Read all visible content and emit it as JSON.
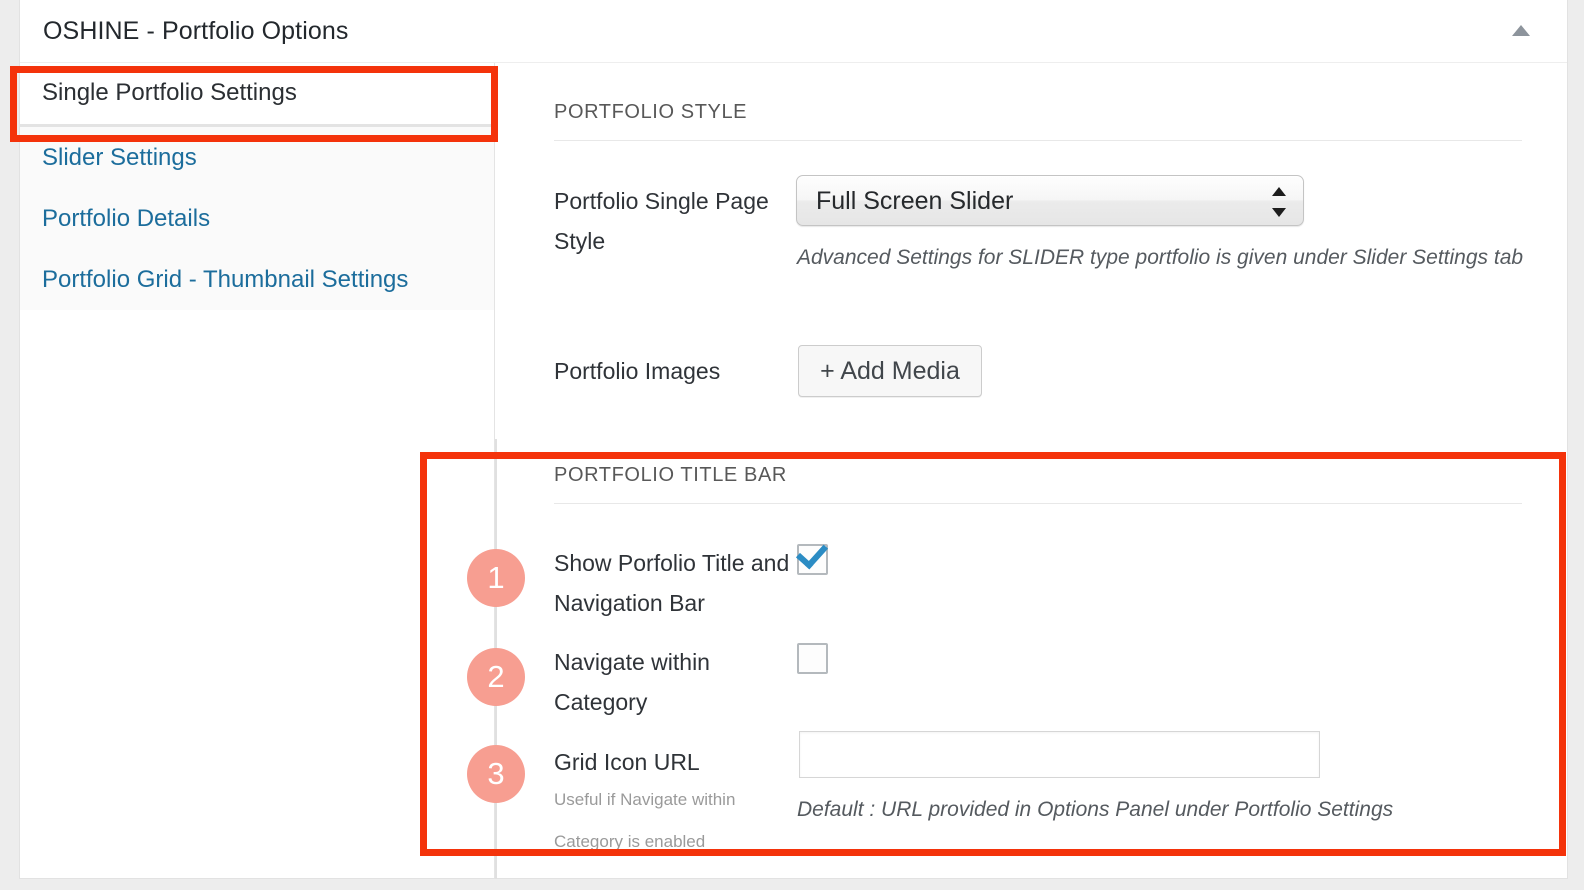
{
  "metabox": {
    "title": "OSHINE - Portfolio Options",
    "toggle_icon": "triangle-up-icon",
    "accent_highlight_color": "#f4330b",
    "badge_color": "#f79e91",
    "link_color": "#1c6d9c"
  },
  "nav": {
    "items": [
      {
        "label": "Single Portfolio Settings",
        "active": true
      },
      {
        "label": "Slider Settings",
        "active": false
      },
      {
        "label": "Portfolio Details",
        "active": false
      },
      {
        "label": "Portfolio Grid - Thumbnail Settings",
        "active": false
      }
    ]
  },
  "sections": [
    {
      "heading": "PORTFOLIO STYLE",
      "fields": [
        {
          "label": "Portfolio Single Page Style",
          "control": "select",
          "value": "Full Screen Slider",
          "description": "Advanced Settings for SLIDER type portfolio is given under Slider Settings tab"
        },
        {
          "label": "Portfolio Images",
          "control": "button",
          "button_label": "+ Add Media"
        }
      ]
    },
    {
      "heading": "PORTFOLIO TITLE BAR",
      "fields": [
        {
          "badge": "1",
          "label": "Show Porfolio Title and Navigation Bar",
          "control": "checkbox",
          "checked": true
        },
        {
          "badge": "2",
          "label": "Navigate within Category",
          "control": "checkbox",
          "checked": false
        },
        {
          "badge": "3",
          "label": "Grid Icon URL",
          "sublabel": "Useful if Navigate within Category is enabled",
          "control": "text",
          "value": "",
          "placeholder": "",
          "description": "Default : URL provided in Options Panel under Portfolio Settings"
        }
      ]
    }
  ]
}
